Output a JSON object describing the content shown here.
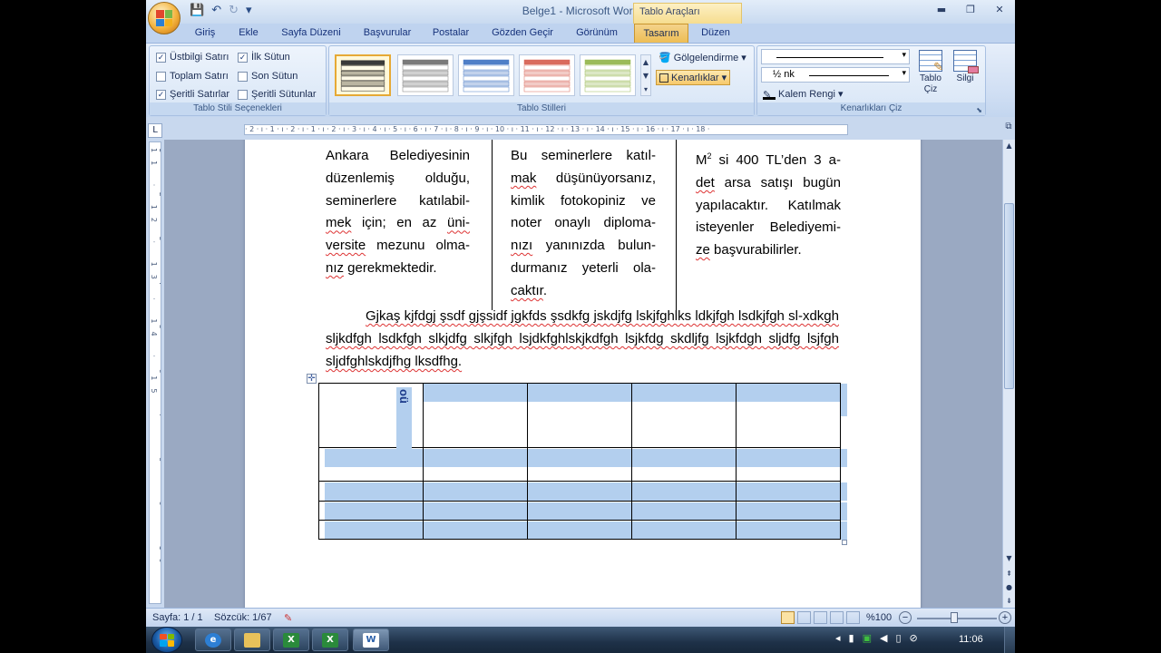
{
  "title": {
    "doc": "Belge1",
    "sep": " - ",
    "app": "Microsoft Word",
    "context_tools": "Tablo Araçları"
  },
  "qat": {
    "save": "💾",
    "undo": "↶",
    "redo": "↻",
    "more": "▾"
  },
  "window": {
    "minimize": "▬",
    "restore": "❐",
    "close": "✕"
  },
  "tabs": [
    "Giriş",
    "Ekle",
    "Sayfa Düzeni",
    "Başvurular",
    "Postalar",
    "Gözden Geçir",
    "Görünüm",
    "Tasarım",
    "Düzen"
  ],
  "active_tab": "Tasarım",
  "help": "?",
  "ribbon": {
    "table_style_options": {
      "label": "Tablo Stili Seçenekleri",
      "checks": [
        {
          "label": "Üstbilgi Satırı",
          "checked": true
        },
        {
          "label": "İlk Sütun",
          "checked": true
        },
        {
          "label": "Toplam Satırı",
          "checked": false
        },
        {
          "label": "Son Sütun",
          "checked": false
        },
        {
          "label": "Şeritli Satırlar",
          "checked": true
        },
        {
          "label": "Şeritli Sütunlar",
          "checked": false
        }
      ]
    },
    "table_styles": {
      "label": "Tablo Stilleri",
      "shading": "Gölgelendirme",
      "borders": "Kenarlıklar",
      "thumb_colors": [
        "#3a3a3a",
        "#7a7a7a",
        "#4f7fc7",
        "#d96b5d",
        "#9bbb59"
      ]
    },
    "draw_borders": {
      "label": "Kenarlıkları Çiz",
      "weight": "½ nk",
      "pen_color": "Kalem Rengi",
      "draw_table": "Tablo\nÇiz",
      "eraser": "Silgi"
    }
  },
  "ruler": {
    "tab_selector": "L",
    "h_marks": "· 2 · ı · 1 · ı · 2 · ı · 1 · ı · 2 · ı · 3 · ı · 4 · ı · 5 · ı · 6 · ı · 7 · ı · 8 · ı · 9 · ı · 10 · ı · 11 · ı · 12 · ı · 13 · ı · 14 · ı · 15 · ı · 16 · ı · 17 · ı · 18 ·",
    "v_marks": "1 · 2 · 3 · 4 · 5 · 6 · 7 · 8 · 9 · 10 · 11 · 12 · 13 · 14 · 15"
  },
  "document": {
    "col1": [
      "Ankara Belediyesinin düzenlemiş olduğu, seminerlere katılabil-",
      "mek",
      " için; en az ",
      "üni-",
      "versite",
      " mezunu olma-",
      "nız",
      " gerekmektedir."
    ],
    "col2": [
      "Bu seminerlere katıl-",
      "mak",
      " düşünüyorsanız, kimlik fotokopiniz ve noter onaylı diploma-",
      "nızı",
      " yanınızda bulun-durmanız yeterli ola-",
      "caktır",
      "."
    ],
    "col3": [
      "M",
      "2",
      " si 400 TL’den 3 a-",
      "det",
      " arsa satışı bugün yapılacaktır. Katılmak isteyenler Belediyemi-",
      "ze",
      " başvurabilirler."
    ],
    "paragraph": "Gjkaş kjfdgj şsdf gjşsidf jgkfds şsdkfg jskdjfg lskjfghlks ldkjfgh lsdkjfgh sl-xdkgh sljkdfgh lsdkfgh slkjdfg slkjfgh lsjdkfghlskjkdfgh lsjkfdg skdljfg lsjkfdgh sljdfg lsjfgh sljdfghlskdjfhg lksdfhg.",
    "table_cell_text": "oü"
  },
  "status": {
    "page": "Sayfa: 1 / 1",
    "words": "Sözcük: 1/67",
    "zoom": "%100",
    "zoom_minus": "−",
    "zoom_plus": "+"
  },
  "taskbar": {
    "clock": "11:06",
    "apps": [
      "IE",
      "Explorer",
      "Excel",
      "Excel",
      "Word"
    ]
  }
}
